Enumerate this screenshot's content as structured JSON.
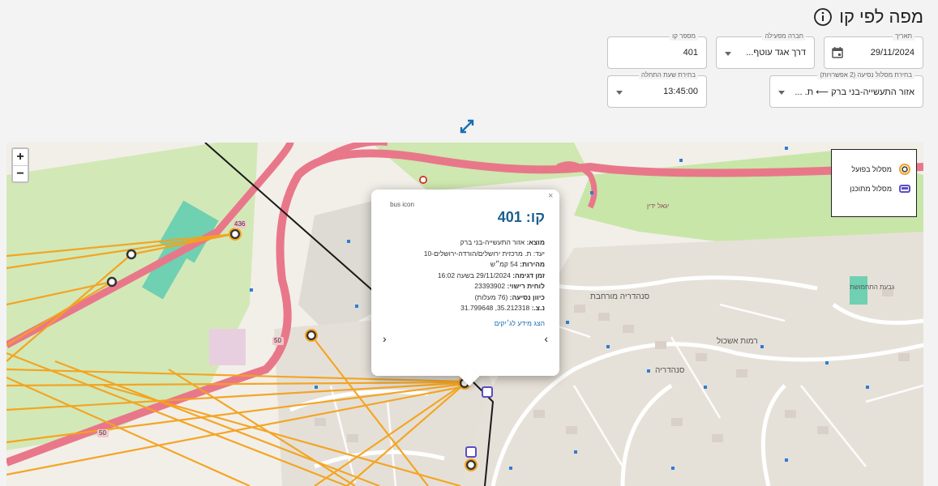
{
  "page": {
    "title": "מפה לפי קו"
  },
  "filters": {
    "date": {
      "label": "תאריך",
      "value": "29/11/2024"
    },
    "operator": {
      "label": "חברה מפעילה",
      "value": "דרך אגד עוטף..."
    },
    "line_number": {
      "label": "מספר קו",
      "value": "401"
    },
    "route": {
      "label": "בחירת מסלול נסיעה (2 אפשרויות)",
      "value": "אזור התעשייה-בני ברק ⟵ ת. ..."
    },
    "start_time": {
      "label": "בחירת שעת התחלה",
      "value": "13:45:00"
    }
  },
  "map": {
    "zoom_in": "+",
    "zoom_out": "−",
    "legend": [
      {
        "label": "מסלול בפועל",
        "icon": "bus-stop-orange-icon",
        "color": "#f5a21b"
      },
      {
        "label": "מסלול מתוכנן",
        "icon": "bus-purple-icon",
        "color": "#5b4ec2"
      }
    ],
    "popup": {
      "close": "×",
      "line_label": "קו:",
      "line_number": "401",
      "image_alt": "bus icon",
      "origin_label": "מוצא:",
      "origin": "אזור התעשייה-בני ברק",
      "destination_label": "יעד:",
      "destination": "ת. מרכזית ירושלים/הורדה-ירושלים-10",
      "speed_label": "מהירות:",
      "speed": "54 קמ״ש",
      "sample_time_label": "זמן דגימה:",
      "sample_time": "29/11/2024 בשעה 16:02",
      "plate_label": "לוחית רישוי:",
      "plate": "23393902",
      "direction_label": "כיוון נסיעה:",
      "direction": "(76 מעלות)",
      "coords_label": "נ.צ.:",
      "coords": "35.212318, 31.799648",
      "link": "הצג מידע לג׳יקים",
      "prev": "‹",
      "next": "›"
    },
    "labels": {
      "neighborhood_1": "סנהדריה",
      "neighborhood_2": "רמות אשכול",
      "neighborhood_3": "סנהדריה מורחבת",
      "road_1": "יגאל ידין",
      "road_2": "גבעת התחמושת",
      "road_sign_436": "436",
      "road_sign_50a": "50",
      "road_sign_50b": "50"
    }
  },
  "colors": {
    "accent": "#1a6fb0",
    "route_orange": "#f5a21b",
    "planned_purple": "#5b4ec2",
    "road_pink": "#e9778a",
    "green_area": "#c8e6a8"
  }
}
